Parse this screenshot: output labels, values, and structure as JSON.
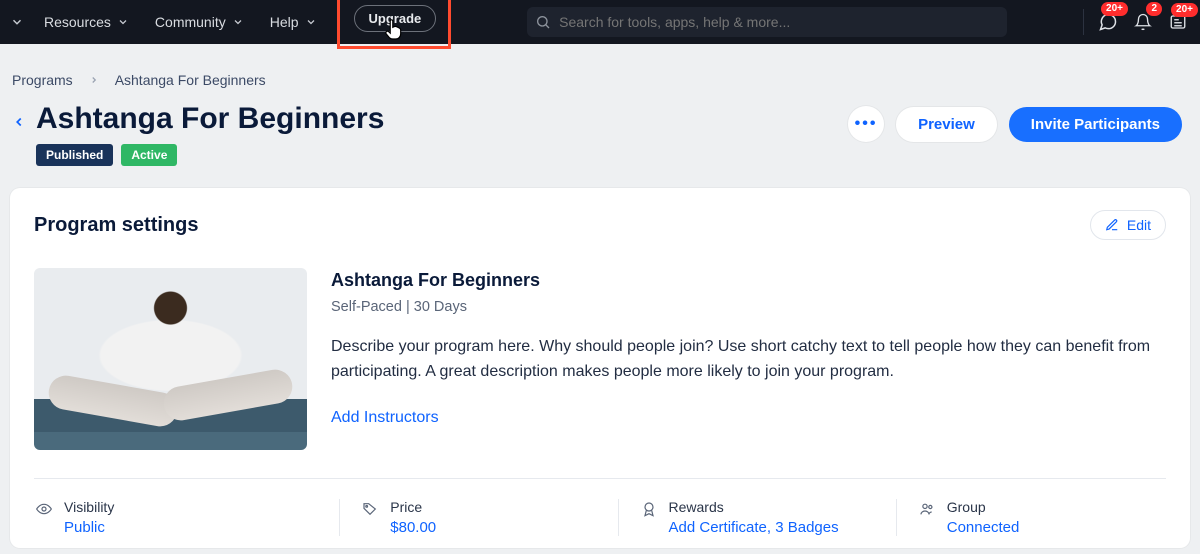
{
  "header": {
    "nav": [
      {
        "label": "Resources"
      },
      {
        "label": "Community"
      },
      {
        "label": "Help"
      }
    ],
    "upgrade_label": "Upgrade",
    "search_placeholder": "Search for tools, apps, help & more...",
    "badges": {
      "chat": "20+",
      "bell": "2",
      "news": "20+"
    }
  },
  "breadcrumb": {
    "root": "Programs",
    "current": "Ashtanga For Beginners"
  },
  "page": {
    "title": "Ashtanga For Beginners",
    "status_published": "Published",
    "status_active": "Active",
    "preview_label": "Preview",
    "invite_label": "Invite Participants"
  },
  "settings": {
    "card_title": "Program settings",
    "edit_label": "Edit",
    "program_name": "Ashtanga For Beginners",
    "program_sub": "Self-Paced | 30 Days",
    "program_desc": "Describe your program here. Why should people join? Use short catchy text to tell people how they can benefit from participating. A great description makes people more likely to join your program.",
    "add_instructors": "Add Instructors",
    "meta": {
      "visibility": {
        "label": "Visibility",
        "value": "Public"
      },
      "price": {
        "label": "Price",
        "value": "$80.00"
      },
      "rewards": {
        "label": "Rewards",
        "value": "Add Certificate, 3 Badges"
      },
      "group": {
        "label": "Group",
        "value": "Connected"
      }
    }
  }
}
